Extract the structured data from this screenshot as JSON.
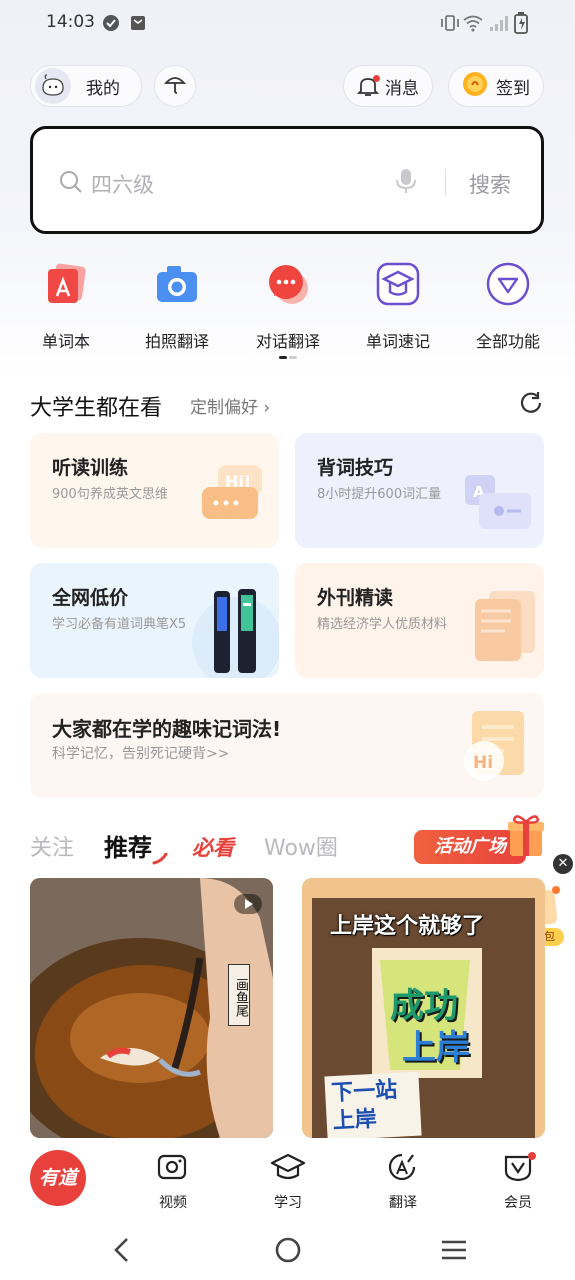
{
  "status": {
    "time": "14:03"
  },
  "header": {
    "mine_label": "我的",
    "messages_label": "消息",
    "checkin_label": "签到"
  },
  "search": {
    "placeholder": "四六级",
    "button_label": "搜索"
  },
  "tools": [
    {
      "label": "单词本",
      "icon": "wordbook-icon"
    },
    {
      "label": "拍照翻译",
      "icon": "camera-icon"
    },
    {
      "label": "对话翻译",
      "icon": "chat-icon"
    },
    {
      "label": "单词速记",
      "icon": "graduation-cap-icon"
    },
    {
      "label": "全部功能",
      "icon": "all-functions-icon"
    }
  ],
  "section": {
    "title": "大学生都在看",
    "customize_label": "定制偏好 ›"
  },
  "cards": [
    {
      "title": "听读训练",
      "subtitle": "900句养成英文思维"
    },
    {
      "title": "背词技巧",
      "subtitle": "8小时提升600词汇量"
    },
    {
      "title": "全网低价",
      "subtitle": "学习必备有道词典笔X5"
    },
    {
      "title": "外刊精读",
      "subtitle": "精选经济学人优质材料"
    },
    {
      "title": "大家都在学的趣味记词法!",
      "subtitle": "科学记忆，告别死记硬背>>"
    }
  ],
  "feed_tabs": {
    "follow": "关注",
    "recommend": "推荐",
    "must_see": "必看",
    "wow": "Wow圈",
    "activity": "活动广场",
    "gift": "加油礼包"
  },
  "feed": [
    {
      "caption": "画鱼尾"
    },
    {
      "headline": "上岸这个就够了",
      "poster_top": "成功",
      "poster_bottom": "上岸",
      "sign": "下一站 上岸"
    }
  ],
  "bottom_nav": {
    "home": "有道",
    "items": [
      "视频",
      "学习",
      "翻译",
      "会员"
    ]
  },
  "colors": {
    "accent_red": "#e8413c",
    "brand_purple": "#6a5ad6"
  }
}
